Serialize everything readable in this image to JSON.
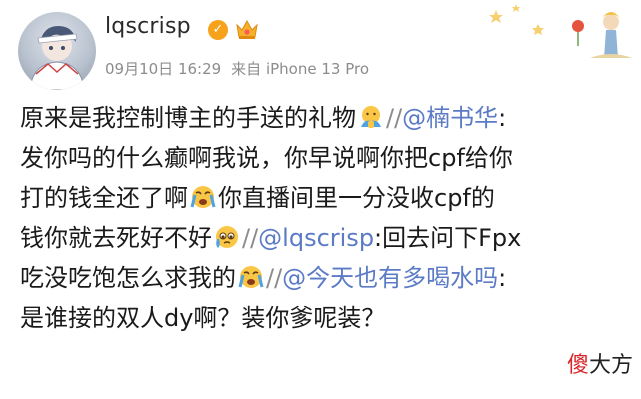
{
  "post": {
    "author": {
      "name": "lqscrisp",
      "verified": true
    },
    "date": "09月10日 16:29",
    "source": "来自 iPhone 13 Pro",
    "lines": {
      "l1_a": "原来是我控制博主的手送的礼物",
      "l1_b": "//",
      "l1_c": "@楠书华",
      "l1_d": ":",
      "l2": "发你吗的什么癫啊我说，你早说啊你把cpf给你",
      "l3_a": "打的钱全还了啊",
      "l3_b": "你直播间里一分没收cpf的",
      "l4_a": "钱你就去死好不好",
      "l4_b": "//",
      "l4_c": "@lqscrisp",
      "l4_d": ":回去问下Fpx",
      "l5_a": "吃没吃饱怎么求我的",
      "l5_b": "//",
      "l5_c": "@今天也有多喝水吗",
      "l5_d": ":",
      "l6": "是谁接的双人dy啊？装你爹呢装？"
    }
  },
  "watermark": {
    "accent": "傻",
    "rest": "大方"
  },
  "colors": {
    "mention": "#5b7bc6",
    "meta": "#8c8c8c",
    "badge": "#f7a21b",
    "watermark_accent": "#d8242a"
  },
  "icons": [
    "verified-icon",
    "crown-icon",
    "hand-emoji",
    "crying-emoji",
    "pleading-emoji"
  ]
}
